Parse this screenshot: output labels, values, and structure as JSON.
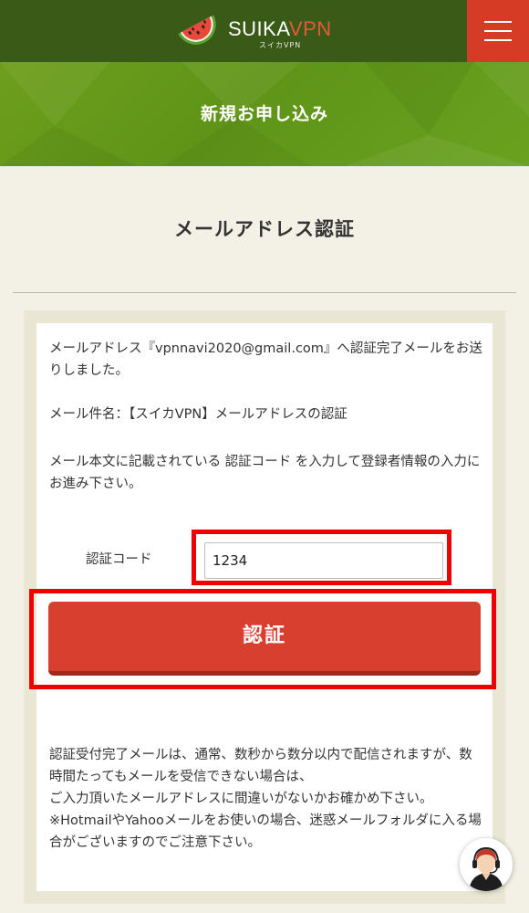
{
  "header": {
    "logo_suika": "SUIKA",
    "logo_vpn": "VPN",
    "logo_sub": "スイカVPN",
    "menu_icon": "hamburger-menu-icon",
    "bg_color": "#3a5a17",
    "menu_color": "#d63b26"
  },
  "banner": {
    "title": "新規お申し込み",
    "bg_color": "#6a9e1c"
  },
  "main": {
    "heading": "メールアドレス認証",
    "intro": "メールアドレス『vpnnavi2020@gmail.com』へ認証完了メールをお送りしました。",
    "subject": "メール件名：【スイカVPN】メールアドレスの認証",
    "instruction": "メール本文に記載されている 認証コード を入力して登録者情報の入力にお進み下さい。",
    "form": {
      "code_label": "認証コード",
      "code_value": "1234"
    },
    "submit_label": "認証",
    "notes": [
      "認証受付完了メールは、通常、数秒から数分以内で配信されますが、数時間たってもメールを受信できない場合は、",
      "ご入力頂いたメールアドレスに間違いがないかお確かめ下さい。",
      "※HotmailやYahooメールをお使いの場合、迷惑メールフォルダに入る場合がございますのでご注意下さい。"
    ]
  },
  "chat": {
    "icon": "support-agent-icon"
  },
  "colors": {
    "accent_red": "#d93f2f",
    "highlight": "#ee0000",
    "page_bg": "#f3f1e6"
  }
}
